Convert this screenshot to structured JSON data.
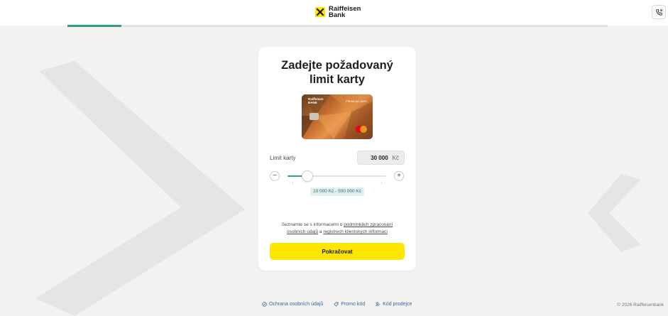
{
  "brand": {
    "name_line1": "Raiffeisen",
    "name_line2": "Bank",
    "color": "#ffe600"
  },
  "header": {
    "phone_icon": "phone-icon",
    "progress_fraction": 0.1
  },
  "form": {
    "title_line1": "Zadejte požadovaný",
    "title_line2": "limit karty",
    "card_image": {
      "brand_line1": "Raiffeisen",
      "brand_line2": "BANK",
      "tier": "PREMIUM CARD",
      "network_icon": "mastercard-logo"
    },
    "limit": {
      "label": "Limit karty",
      "value": "30 000",
      "unit": "Kč",
      "min": 10000,
      "max": 500000,
      "current": 30000,
      "range_text": "10 000 Kč - 500 000 Kč"
    },
    "decrease_label": "−",
    "increase_label": "+",
    "consent": {
      "prefix": "Seznamte se s informacemi o ",
      "link1": "podmínkách zpracování osobních údajů",
      "middle": " a ",
      "link2": "registrech klientských informací"
    },
    "continue_label": "Pokračovat"
  },
  "footer": {
    "links": [
      {
        "label": "Ochrana osobních údajů",
        "icon": "shield-icon"
      },
      {
        "label": "Promo kód",
        "icon": "tag-icon"
      },
      {
        "label": "Kód prodejce",
        "icon": "user-key-icon"
      }
    ],
    "copyright": "© 2026 Raiffeisenbank"
  },
  "colors": {
    "accent": "#2e9f8d",
    "button": "#ffe600",
    "link": "#2b6aa6",
    "background": "#f3f2f1"
  }
}
